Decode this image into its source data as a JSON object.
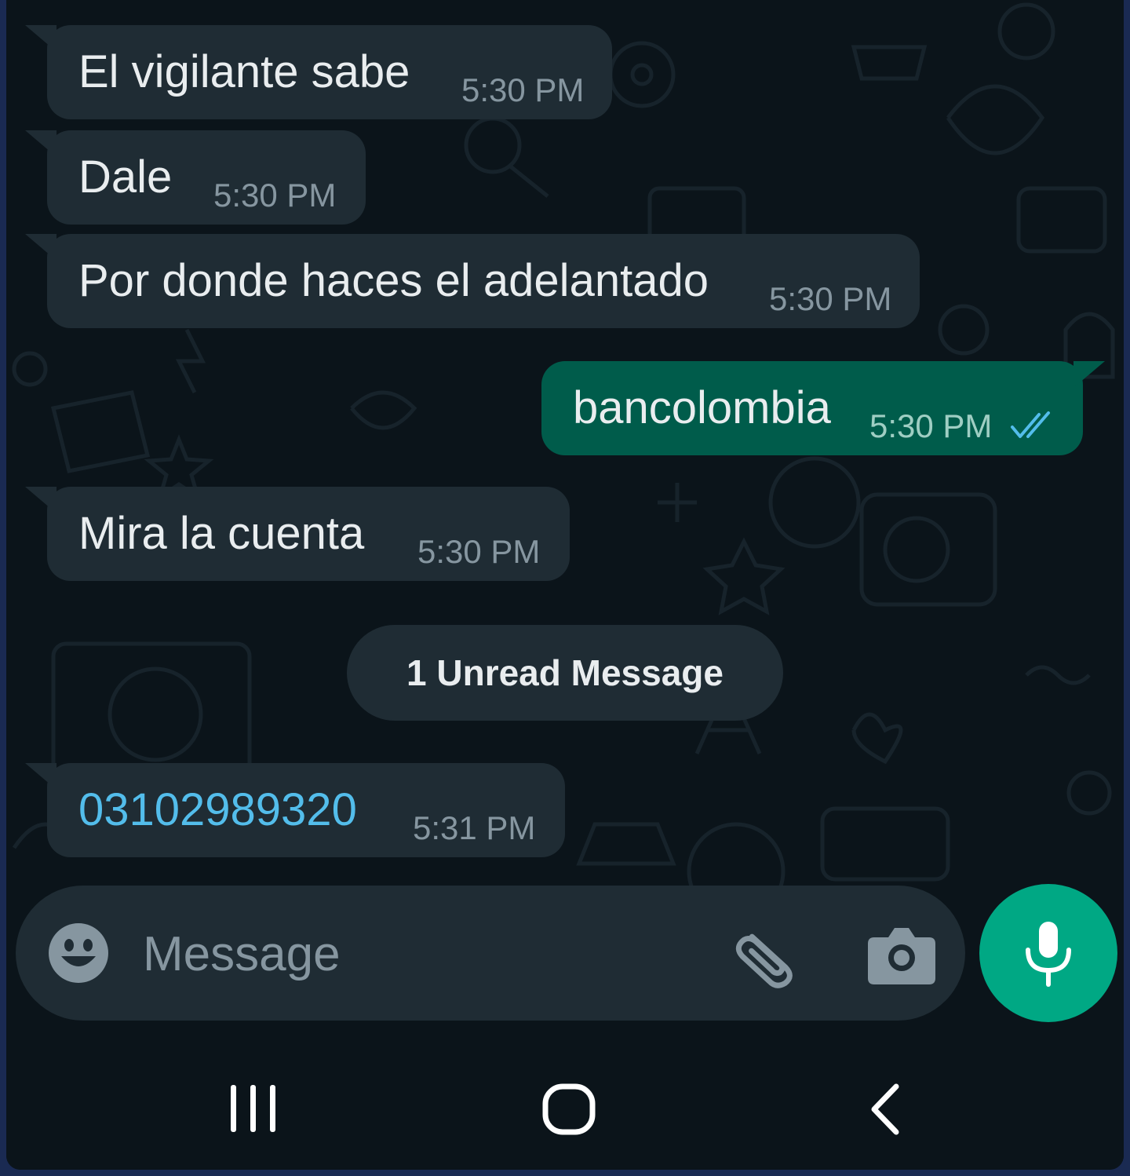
{
  "messages": [
    {
      "text": "El vigilante sabe",
      "time": "5:30 PM",
      "direction": "incoming"
    },
    {
      "text": "Dale",
      "time": "5:30 PM",
      "direction": "incoming"
    },
    {
      "text": "Por donde haces el adelantado",
      "time": "5:30 PM",
      "direction": "incoming"
    },
    {
      "text": "bancolombia",
      "time": "5:30 PM",
      "direction": "outgoing",
      "status": "read"
    },
    {
      "text": "Mira la cuenta",
      "time": "5:30 PM",
      "direction": "incoming"
    },
    {
      "text": "03102989320",
      "time": "5:31 PM",
      "direction": "incoming",
      "is_link": true
    }
  ],
  "unread_divider": "1 Unread Message",
  "composer": {
    "placeholder": "Message",
    "icons": [
      "emoji-icon",
      "paperclip-icon",
      "camera-icon",
      "microphone-icon"
    ]
  },
  "navbar": {
    "icons": [
      "recent-apps-icon",
      "home-icon",
      "back-icon"
    ]
  },
  "colors": {
    "background": "#0b141a",
    "incoming_bubble": "#1f2c34",
    "outgoing_bubble": "#005c4b",
    "accent": "#00a884",
    "link": "#53bdeb",
    "read_ticks": "#53bdeb"
  }
}
